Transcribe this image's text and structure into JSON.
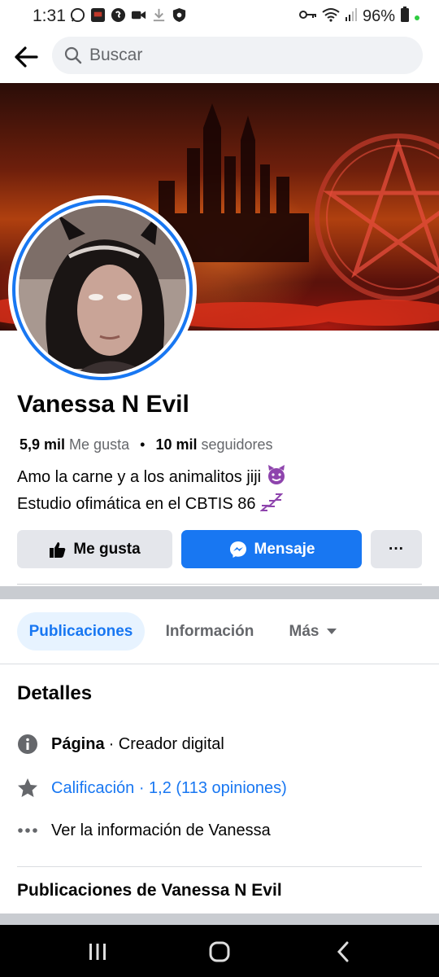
{
  "status_bar": {
    "time": "1:31",
    "battery": "96%",
    "icons": [
      "whatsapp-icon",
      "news-icon",
      "shazam-icon",
      "video-icon",
      "download-icon",
      "shield-icon",
      "key-icon",
      "wifi-icon",
      "signal-icon",
      "battery-icon"
    ]
  },
  "header": {
    "search_placeholder": "Buscar"
  },
  "profile": {
    "name": "Vanessa N Evil",
    "likes_count": "5,9 mil",
    "likes_label": "Me gusta",
    "followers_count": "10 mil",
    "followers_label": "seguidores",
    "bio_line1": "Amo la carne y a los animalitos jiji",
    "bio_line2": "Estudio ofimática en el CBTIS 86"
  },
  "actions": {
    "like_label": "Me gusta",
    "message_label": "Mensaje",
    "more_label": "···"
  },
  "tabs": [
    {
      "label": "Publicaciones",
      "active": true
    },
    {
      "label": "Información",
      "active": false
    },
    {
      "label": "Más",
      "active": false
    }
  ],
  "details": {
    "title": "Detalles",
    "page_label": "Página",
    "page_value": "· Creador digital",
    "rating_text": "Calificación · 1,2 (113 opiniones)",
    "see_info_text": "Ver la información de Vanessa"
  },
  "posts_section": {
    "title": "Publicaciones de Vanessa N Evil"
  },
  "colors": {
    "accent": "#1877f2",
    "button_gray": "#e4e6eb",
    "text_secondary": "#65676b"
  }
}
